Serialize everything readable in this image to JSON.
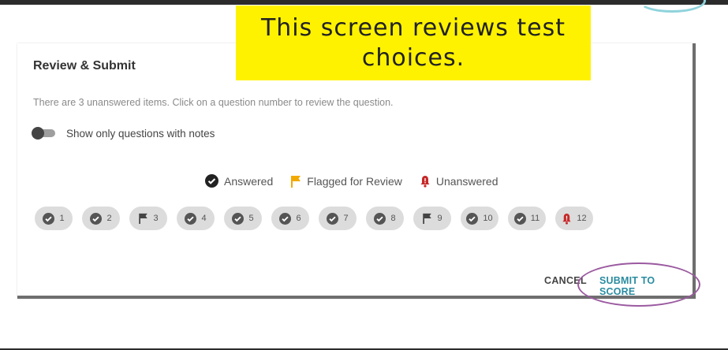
{
  "callout": {
    "line1": "This screen reviews test",
    "line2": "choices."
  },
  "dialog": {
    "title": "Review & Submit",
    "info": "There are 3 unanswered items. Click on a question number to review the question.",
    "toggle_label": "Show only questions with notes",
    "toggle_on": false
  },
  "legend": {
    "answered": "Answered",
    "flagged": "Flagged for Review",
    "unanswered": "Unanswered"
  },
  "questions": [
    {
      "num": "1",
      "status": "answered"
    },
    {
      "num": "2",
      "status": "answered"
    },
    {
      "num": "3",
      "status": "flagged"
    },
    {
      "num": "4",
      "status": "answered"
    },
    {
      "num": "5",
      "status": "answered"
    },
    {
      "num": "6",
      "status": "answered"
    },
    {
      "num": "7",
      "status": "answered"
    },
    {
      "num": "8",
      "status": "answered"
    },
    {
      "num": "9",
      "status": "flagged"
    },
    {
      "num": "10",
      "status": "answered"
    },
    {
      "num": "11",
      "status": "answered"
    },
    {
      "num": "12",
      "status": "unanswered"
    }
  ],
  "actions": {
    "cancel": "CANCEL",
    "submit": "SUBMIT TO SCORE"
  },
  "colors": {
    "accent": "#2a8ca0",
    "flag": "#f2a900",
    "alert": "#c62828",
    "callout": "#fff200",
    "annotation": "#9b5aa0"
  }
}
